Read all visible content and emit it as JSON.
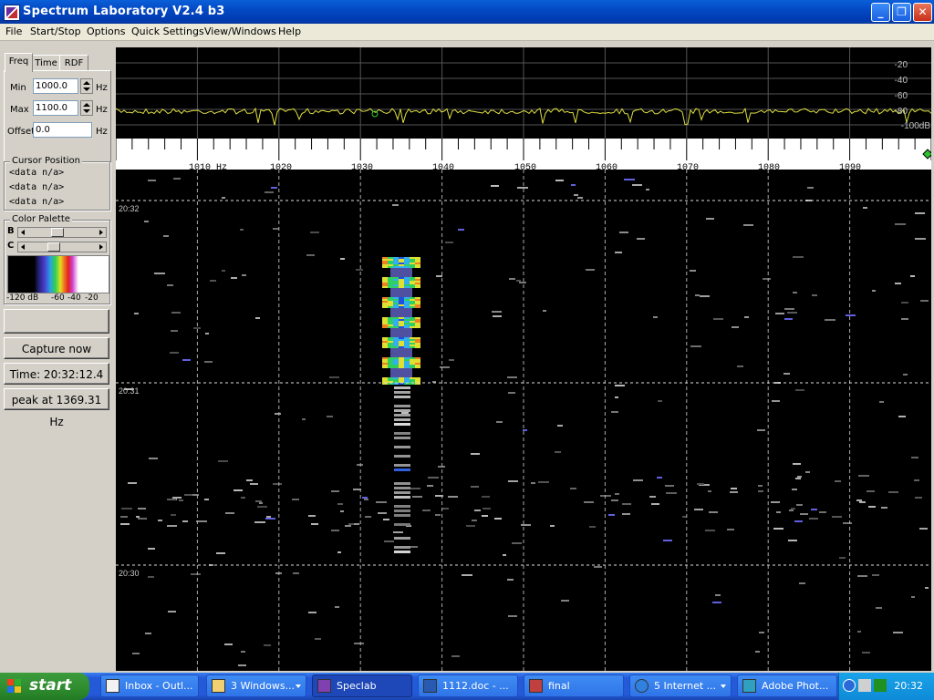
{
  "window": {
    "title": "Spectrum Laboratory V2.4 b3"
  },
  "menu": [
    "File",
    "Start/Stop",
    "Options",
    "Quick Settings",
    "View/Windows",
    "Help"
  ],
  "tabs": [
    "Freq",
    "Time",
    "RDF"
  ],
  "freq": {
    "min_label": "Min",
    "min_value": "1000.0",
    "min_unit": "Hz",
    "max_label": "Max",
    "max_value": "1100.0",
    "max_unit": "Hz",
    "offset_label": "Offset",
    "offset_value": "0.0",
    "offset_unit": "Hz"
  },
  "cursor": {
    "title": "Cursor Position",
    "lines": [
      "<data n/a>",
      "<data n/a>",
      "<data n/a>"
    ]
  },
  "palette": {
    "title": "Color Palette",
    "b_label": "B",
    "c_label": "C",
    "scale": [
      "-120 dB",
      "-60",
      "-40",
      "-20"
    ],
    "b_level": 0.45,
    "c_level": 0.4
  },
  "buttons": {
    "capture": "Capture now",
    "time": "Time:  20:32:12.4",
    "peak": "peak at 1369.31 Hz"
  },
  "spectrum": {
    "db_labels": [
      "-20",
      "-40",
      "-60",
      "-80",
      "-100dB"
    ],
    "freq_labels": [
      "1010 Hz",
      "1020",
      "1030",
      "1040",
      "1050",
      "1060",
      "1070",
      "1080",
      "1090"
    ],
    "trace_color": "#e0e040"
  },
  "waterfall": {
    "time_labels": [
      "20:32",
      "20:31",
      "20:30"
    ],
    "signal_freq_hz": 1035
  },
  "taskbar": {
    "start": "start",
    "tasks": [
      "Inbox - Outl...",
      "3 Windows...",
      "Speclab",
      "1112.doc - ...",
      "final",
      "5 Internet ...",
      "Adobe Phot..."
    ],
    "clock": "20:32"
  }
}
